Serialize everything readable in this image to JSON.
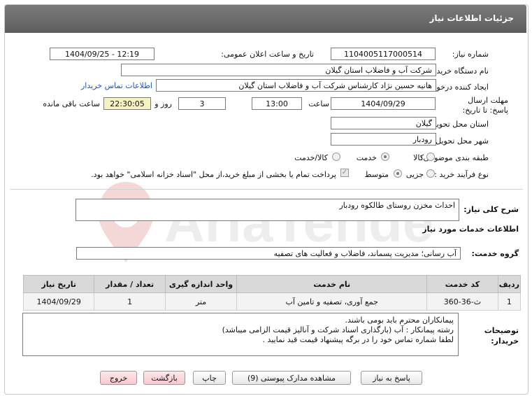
{
  "header": {
    "title": "جزئیات اطلاعات نیاز"
  },
  "fields": {
    "need_number_label": "شماره نیاز:",
    "need_number": "1104005117000514",
    "announce_label": "تاریخ و ساعت اعلان عمومی:",
    "announce_value": "1404/09/25 - 12:19",
    "buyer_org_label": "نام دستگاه خریدار:",
    "buyer_org": "شرکت آب و فاضلاب استان گیلان",
    "creator_label": "ایجاد کننده درخواست:",
    "creator": "هانیه حسین نژاد کارشناس شرکت آب و فاضلاب استان گیلان",
    "contact_link": "اطلاعات تماس خریدار",
    "deadline_label": "مهلت ارسال پاسخ: تا تاریخ:",
    "deadline_date": "1404/09/29",
    "time_label": "ساعت",
    "deadline_time": "13:00",
    "days_value": "3",
    "days_label": "روز و",
    "remaining_time": "22:30:05",
    "remaining_label": "ساعت باقی مانده",
    "province_label": "استان محل تحویل:",
    "province": "گیلان",
    "city_label": "شهر محل تحویل:",
    "city": "رودبار",
    "category_label": "طبقه بندی موضوعی:",
    "cat_goods": "کالا",
    "cat_service": "خدمت",
    "cat_both": "کالا/خدمت",
    "process_label": "نوع فرآیند خرید :",
    "proc_small": "جزیی",
    "proc_medium": "متوسط",
    "treasury_note": "پرداخت تمام یا بخشی از مبلغ خرید،از محل \"اسناد خزانه اسلامی\" خواهد بود."
  },
  "summary": {
    "label": "شرح کلی نیاز:",
    "value": "احداث مخزن روستای طالکوه  رودبار"
  },
  "services": {
    "section_title": "اطلاعات خدمات مورد نیاز",
    "group_label": "گروه خدمت:",
    "group_value": "آب رسانی؛ مدیریت پسماند، فاضلاب و فعالیت های تصفیه",
    "columns": [
      "ردیف",
      "کد خدمت",
      "نام خدمت",
      "واحد اندازه گیری",
      "تعداد / مقدار",
      "تاریخ نیاز"
    ],
    "rows": [
      [
        "1",
        "ث-36-360",
        "جمع آوری، تصفیه و تامین آب",
        "متر",
        "1",
        "1404/09/29"
      ]
    ]
  },
  "buyer_notes": {
    "label": "توضیحات خریدار:",
    "lines": [
      "پیمانکاران محترم باید بومی باشند.",
      "رشته پیمانکار :   آب (بارگذاری اسناد شرکت و آنالیز قیمت  الزامی میباشد)",
      "لطفا شماره تماس خود را در برگه پیشنهاد قیمت قید نمایید ."
    ]
  },
  "buttons": {
    "reply": "پاسخ به نیاز",
    "attachments": "مشاهده مدارک پیوستی (9)",
    "print": "چاپ",
    "back": "بازگشت",
    "exit": "خروج"
  },
  "watermark": {
    "text": "AriaTender.neT"
  },
  "colors": {
    "title_bar": "#6b6b6b",
    "link": "#1a56c8",
    "remaining_bg": "#f6f2c4",
    "danger_button": "#f6c9cf"
  }
}
